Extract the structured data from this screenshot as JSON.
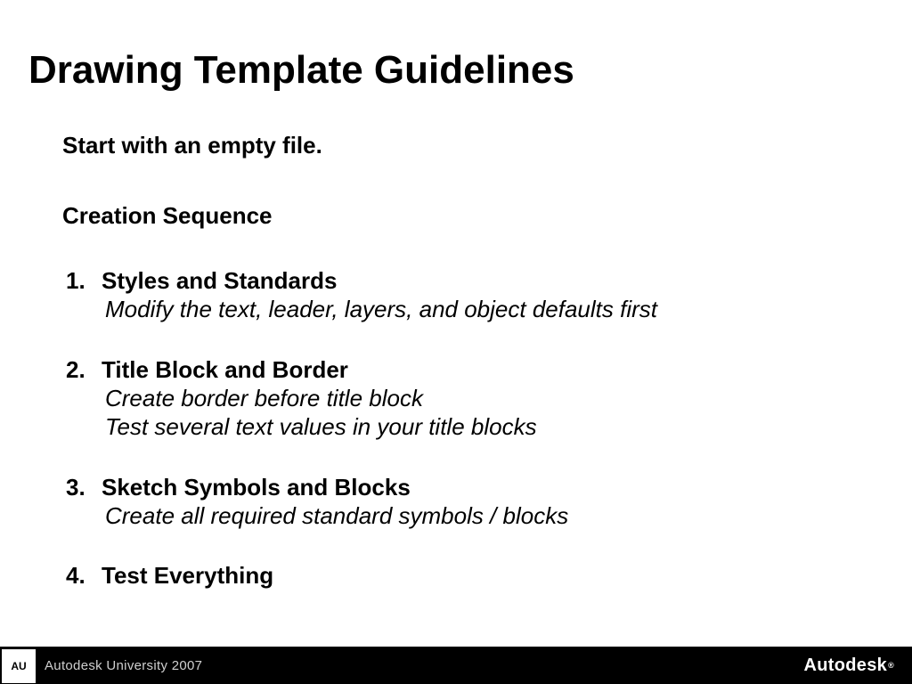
{
  "title": "Drawing Template Guidelines",
  "intro": "Start with an empty file.",
  "subhead": "Creation Sequence",
  "items": [
    {
      "num": "1.",
      "title": "Styles and Standards",
      "desc": [
        "Modify the text, leader, layers, and object defaults first"
      ]
    },
    {
      "num": "2.",
      "title": "Title Block and Border",
      "desc": [
        "Create border before title block",
        "Test several text values in your title blocks"
      ]
    },
    {
      "num": "3.",
      "title": "Sketch Symbols and Blocks",
      "desc": [
        "Create all required standard symbols / blocks"
      ]
    },
    {
      "num": "4.",
      "title": "Test Everything",
      "desc": []
    }
  ],
  "footer": {
    "au_box": "AU",
    "au_text": "Autodesk University 2007",
    "brand": "Autodesk",
    "reg": "®"
  }
}
